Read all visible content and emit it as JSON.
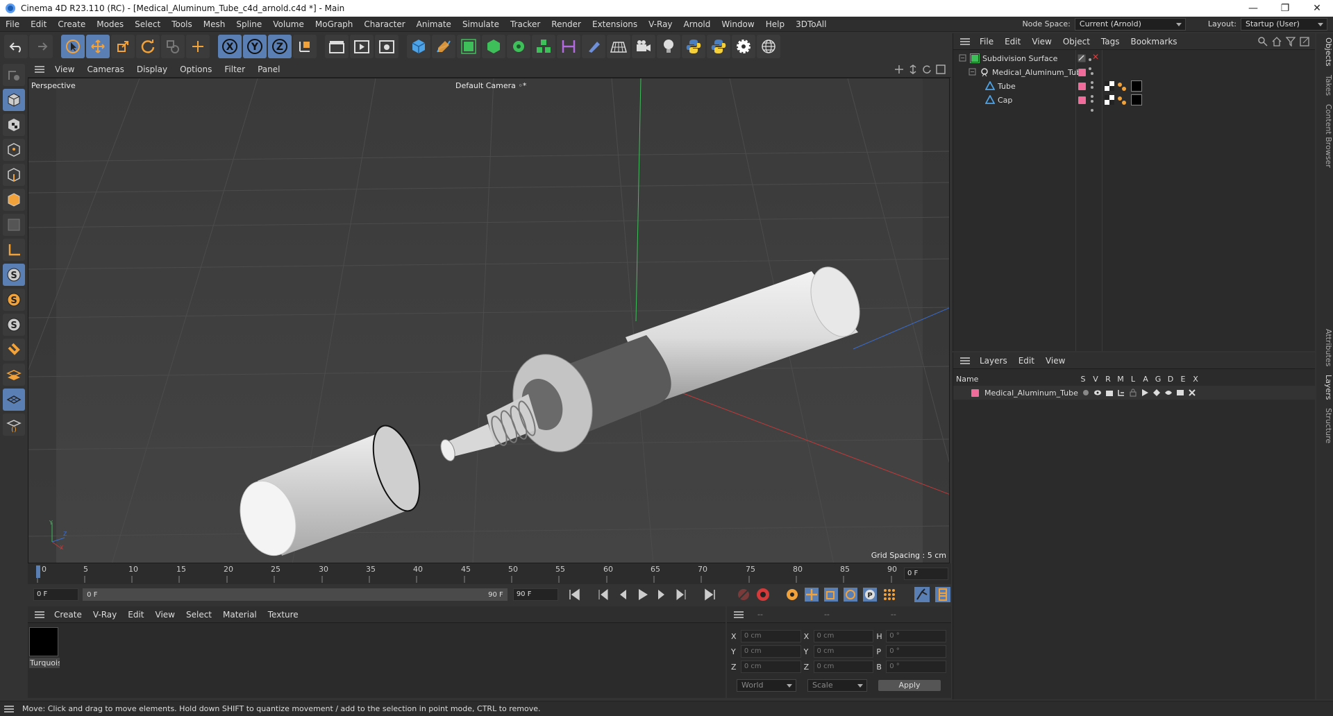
{
  "window": {
    "title": "Cinema 4D R23.110 (RC) - [Medical_Aluminum_Tube_c4d_arnold.c4d *] - Main",
    "minimize": "—",
    "restore": "❐",
    "close": "✕"
  },
  "menu": [
    "File",
    "Edit",
    "Create",
    "Modes",
    "Select",
    "Tools",
    "Mesh",
    "Spline",
    "Volume",
    "MoGraph",
    "Character",
    "Animate",
    "Simulate",
    "Tracker",
    "Render",
    "Extensions",
    "V-Ray",
    "Arnold",
    "Window",
    "Help",
    "3DToAll"
  ],
  "nodespace": {
    "label": "Node Space:",
    "value": "Current (Arnold)"
  },
  "layout": {
    "label": "Layout:",
    "value": "Startup (User)"
  },
  "viewport": {
    "menu": [
      "View",
      "Cameras",
      "Display",
      "Options",
      "Filter",
      "Panel"
    ],
    "label": "Perspective",
    "camera": "Default Camera",
    "camera_icon": "◦*",
    "grid_spacing": "Grid Spacing : 5 cm",
    "axis_y": "Y",
    "axis_z": "Z",
    "axis_x": "X"
  },
  "timeline": {
    "ticks": [
      "0",
      "5",
      "10",
      "15",
      "20",
      "25",
      "30",
      "35",
      "40",
      "45",
      "50",
      "55",
      "60",
      "65",
      "70",
      "75",
      "80",
      "85",
      "90"
    ],
    "current": "0 F"
  },
  "transport": {
    "start": "0 F",
    "range_start": "0 F",
    "range_end": "90 F",
    "end": "90 F"
  },
  "material": {
    "menu": [
      "Create",
      "V-Ray",
      "Edit",
      "View",
      "Select",
      "Material",
      "Texture"
    ],
    "item": "Turquois"
  },
  "coords": {
    "dashes": [
      "--",
      "--",
      "--"
    ],
    "rows": [
      {
        "a": "X",
        "av": "0 cm",
        "b": "X",
        "bv": "0 cm",
        "c": "H",
        "cv": "0 °"
      },
      {
        "a": "Y",
        "av": "0 cm",
        "b": "Y",
        "bv": "0 cm",
        "c": "P",
        "cv": "0 °"
      },
      {
        "a": "Z",
        "av": "0 cm",
        "b": "Z",
        "bv": "0 cm",
        "c": "B",
        "cv": "0 °"
      }
    ],
    "world": "World",
    "scale": "Scale",
    "apply": "Apply"
  },
  "objects": {
    "menu": [
      "File",
      "Edit",
      "View",
      "Object",
      "Tags",
      "Bookmarks"
    ],
    "items": [
      {
        "name": "Subdivision Surface",
        "level": 0
      },
      {
        "name": "Medical_Aluminum_Tube",
        "level": 1
      },
      {
        "name": "Tube",
        "level": 2
      },
      {
        "name": "Cap",
        "level": 2
      }
    ]
  },
  "layers": {
    "menu": [
      "Layers",
      "Edit",
      "View"
    ],
    "cols": [
      "Name",
      "S",
      "V",
      "R",
      "M",
      "L",
      "A",
      "G",
      "D",
      "E",
      "X"
    ],
    "item": "Medical_Aluminum_Tube"
  },
  "sidetabs": [
    "Objects",
    "Takes",
    "Content Browser",
    "Attributes",
    "Layers",
    "Structure"
  ],
  "status": "Move: Click and drag to move elements. Hold down SHIFT to quantize movement / add to the selection in point mode, CTRL to remove.",
  "colors": {
    "accent": "#5a7fb5",
    "layer": "#f06c9b"
  }
}
